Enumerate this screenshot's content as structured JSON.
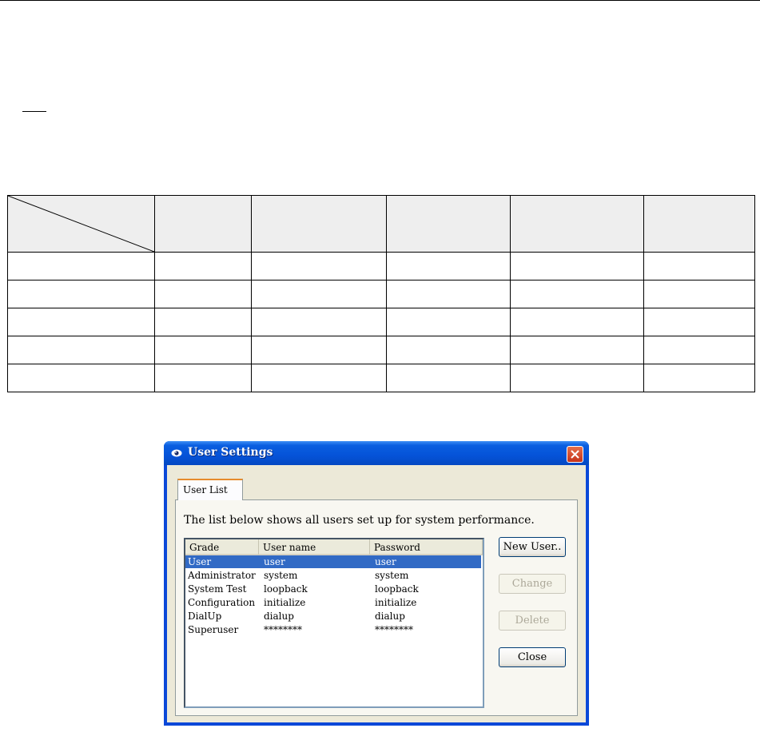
{
  "dialog": {
    "title": "User Settings",
    "tab": "User List",
    "description": "The list below shows all users set up for system performance.",
    "columns": [
      "Grade",
      "User name",
      "Password"
    ],
    "rows": [
      {
        "grade": "User",
        "username": "user",
        "password": "user",
        "selected": true
      },
      {
        "grade": "Administrator",
        "username": "system",
        "password": "system",
        "selected": false
      },
      {
        "grade": "System Test",
        "username": "loopback",
        "password": "loopback",
        "selected": false
      },
      {
        "grade": "Configuration",
        "username": "initialize",
        "password": "initialize",
        "selected": false
      },
      {
        "grade": "DialUp",
        "username": "dialup",
        "password": "dialup",
        "selected": false
      },
      {
        "grade": "Superuser",
        "username": "********",
        "password": "********",
        "selected": false
      }
    ],
    "buttons": {
      "new_user": "New User..",
      "change": "Change",
      "delete": "Delete",
      "close": "Close"
    },
    "button_states": {
      "change_disabled": true,
      "delete_disabled": true
    },
    "colors": {
      "titlebar": "#0553d8",
      "selection": "#316ac5",
      "client": "#ece9d8"
    }
  },
  "icons": {
    "title": "app-icon",
    "close": "close-icon"
  }
}
